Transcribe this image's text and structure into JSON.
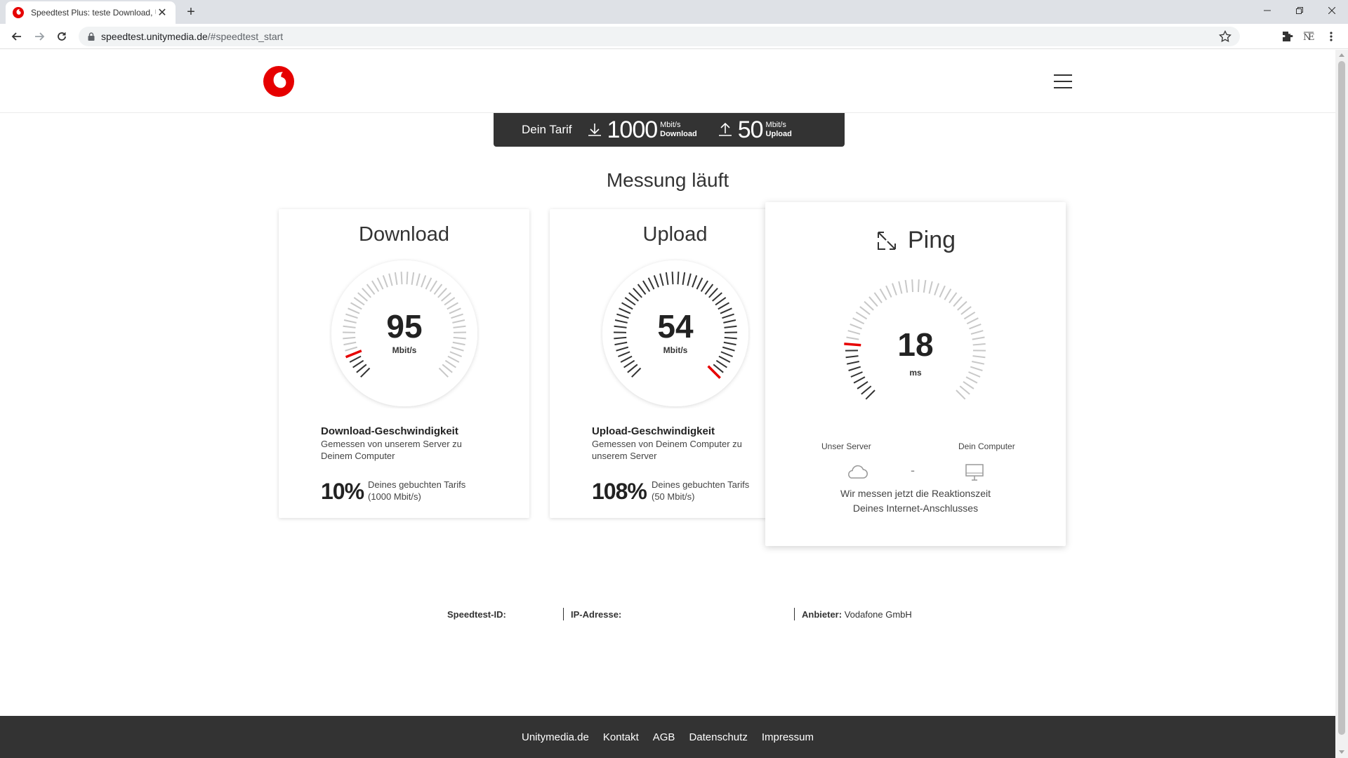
{
  "browser": {
    "tab_title": "Speedtest Plus: teste Download, Upload",
    "url_host": "speedtest.unitymedia.de",
    "url_path": "/#speedtest_start"
  },
  "tariff": {
    "label": "Dein Tarif",
    "download_value": "1000",
    "download_unit": "Mbit/s",
    "download_label": "Download",
    "upload_value": "50",
    "upload_unit": "Mbit/s",
    "upload_label": "Upload"
  },
  "status_title": "Messung läuft",
  "download": {
    "title": "Download",
    "value": "95",
    "unit": "Mbit/s",
    "sub_title": "Download-Geschwindigkeit",
    "sub_text": "Gemessen von unserem Server zu Deinem Computer",
    "percent": "10%",
    "percent_desc_1": "Deines gebuchten Tarifs",
    "percent_desc_2": "(1000 Mbit/s)",
    "gauge_fraction": 0.095
  },
  "upload": {
    "title": "Upload",
    "value": "54",
    "unit": "Mbit/s",
    "sub_title": "Upload-Geschwindigkeit",
    "sub_text": "Gemessen von Deinem Computer zu unserem Server",
    "percent": "108%",
    "percent_desc_1": "Deines gebuchten Tarifs",
    "percent_desc_2": "(50 Mbit/s)",
    "gauge_fraction": 1.0
  },
  "ping": {
    "title": "Ping",
    "value": "18",
    "unit": "ms",
    "server_label": "Unser Server",
    "computer_label": "Dein Computer",
    "separator": "-",
    "message_1": "Wir messen jetzt die Reaktionszeit",
    "message_2": "Deines Internet-Anschlusses",
    "gauge_fraction": 0.18
  },
  "info": {
    "speedtest_id_label": "Speedtest-ID:",
    "ip_label": "IP-Adresse:",
    "provider_label": "Anbieter:",
    "provider_value": "Vodafone GmbH"
  },
  "footer": {
    "links": [
      "Unitymedia.de",
      "Kontakt",
      "AGB",
      "Datenschutz",
      "Impressum"
    ]
  },
  "colors": {
    "brand_red": "#e60000",
    "dark_bar": "#333333",
    "tick_active": "#333333",
    "tick_inactive": "#c8c8c8"
  }
}
